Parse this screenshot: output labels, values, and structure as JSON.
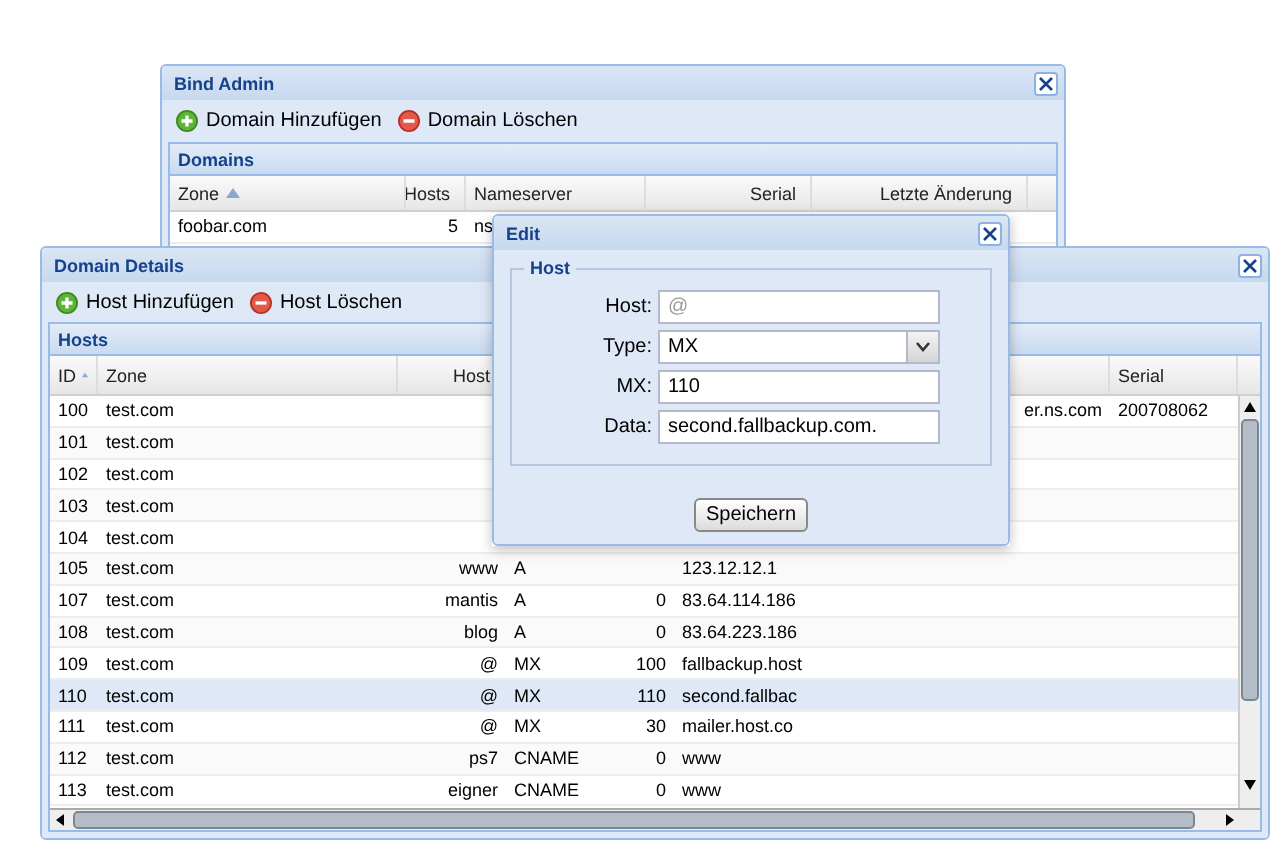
{
  "bind_admin": {
    "title": "Bind Admin",
    "toolbar": [
      {
        "kind": "add",
        "label": "Domain Hinzufügen"
      },
      {
        "kind": "delete",
        "label": "Domain Löschen"
      }
    ],
    "panel_title": "Domains",
    "columns": [
      {
        "label": "Zone",
        "sorted": true
      },
      {
        "label": "Hosts",
        "sorted": false
      },
      {
        "label": "Nameserver",
        "sorted": false
      },
      {
        "label": "Serial",
        "sorted": false
      },
      {
        "label": "Letzte Änderung",
        "sorted": false
      }
    ],
    "rows": [
      {
        "zone": "foobar.com",
        "hosts": "5",
        "nameserver": "ns"
      }
    ]
  },
  "domain_details": {
    "title": "Domain Details",
    "toolbar": [
      {
        "kind": "add",
        "label": "Host Hinzufügen"
      },
      {
        "kind": "delete",
        "label": "Host Löschen"
      }
    ],
    "panel_title": "Hosts",
    "columns": [
      {
        "label": "ID",
        "sorted": true
      },
      {
        "label": "Zone",
        "sorted": false
      },
      {
        "label": "Host",
        "sorted": false
      },
      {
        "label": "Serial",
        "sorted": false
      }
    ],
    "rows": [
      {
        "id": "100",
        "zone": "test.com",
        "column_7": "er.ns.com",
        "serial": "200708062",
        "selected": false
      },
      {
        "id": "101",
        "zone": "test.com",
        "selected": false
      },
      {
        "id": "102",
        "zone": "test.com",
        "selected": false
      },
      {
        "id": "103",
        "zone": "test.com",
        "selected": false
      },
      {
        "id": "104",
        "zone": "test.com",
        "selected": false
      },
      {
        "id": "105",
        "zone": "test.com",
        "host": "www",
        "type": "A",
        "data": "123.12.12.1",
        "selected": false
      },
      {
        "id": "107",
        "zone": "test.com",
        "host": "mantis",
        "type": "A",
        "mx": "0",
        "data": "83.64.114.186",
        "selected": false
      },
      {
        "id": "108",
        "zone": "test.com",
        "host": "blog",
        "type": "A",
        "mx": "0",
        "data": "83.64.223.186",
        "selected": false
      },
      {
        "id": "109",
        "zone": "test.com",
        "host": "@",
        "type": "MX",
        "mx": "100",
        "data": "fallbackup.host",
        "selected": false
      },
      {
        "id": "110",
        "zone": "test.com",
        "host": "@",
        "type": "MX",
        "mx": "110",
        "data": "second.fallbac",
        "selected": true
      },
      {
        "id": "111",
        "zone": "test.com",
        "host": "@",
        "type": "MX",
        "mx": "30",
        "data": "mailer.host.co",
        "selected": false
      },
      {
        "id": "112",
        "zone": "test.com",
        "host": "ps7",
        "type": "CNAME",
        "mx": "0",
        "data": "www",
        "selected": false
      },
      {
        "id": "113",
        "zone": "test.com",
        "host": "eigner",
        "type": "CNAME",
        "mx": "0",
        "data": "www",
        "selected": false
      }
    ]
  },
  "edit": {
    "title": "Edit",
    "fieldset": "Host",
    "fields": [
      {
        "kind": "text",
        "label": "Host:",
        "placeholder": "@"
      },
      {
        "kind": "select",
        "label": "Type:",
        "value": "MX"
      },
      {
        "kind": "text",
        "label": "MX:",
        "value": "110"
      },
      {
        "kind": "text",
        "label": "Data:",
        "value": "second.fallbackup.com."
      }
    ],
    "button": "Speichern"
  }
}
